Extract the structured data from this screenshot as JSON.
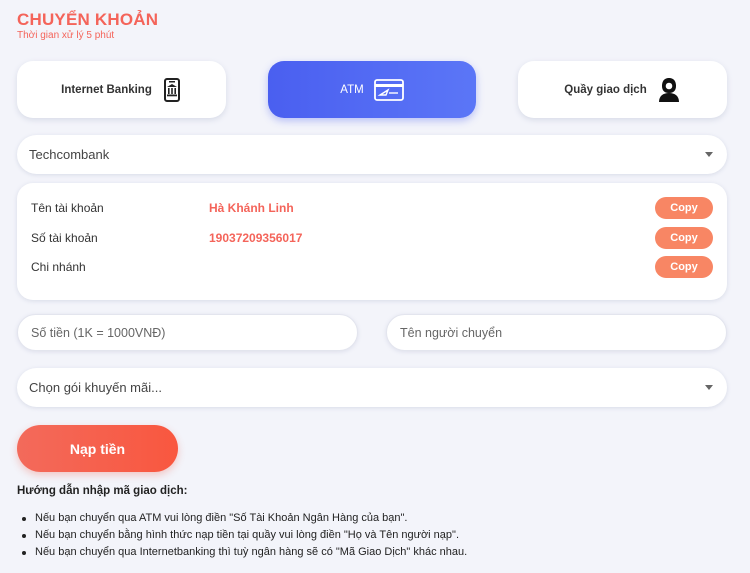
{
  "header": {
    "title": "CHUYỂN KHOẢN",
    "subtitle": "Thời gian xử lý 5 phút"
  },
  "methods": [
    {
      "label": "Internet Banking",
      "icon": "bank-phone-icon",
      "active": false
    },
    {
      "label": "ATM",
      "icon": "atm-card-icon",
      "active": true
    },
    {
      "label": "Quầy giao dịch",
      "icon": "teller-icon",
      "active": false
    }
  ],
  "bank_select": {
    "value": "Techcombank"
  },
  "account": {
    "rows": [
      {
        "key": "Tên tài khoản",
        "value": "Hà Khánh Linh",
        "copy": "Copy"
      },
      {
        "key": "Số tài khoản",
        "value": "19037209356017",
        "copy": "Copy"
      },
      {
        "key": "Chi nhánh",
        "value": "",
        "copy": "Copy"
      }
    ]
  },
  "form": {
    "amount_placeholder": "Số tiền (1K = 1000VNĐ)",
    "sender_placeholder": "Tên người chuyển"
  },
  "promo_select": {
    "value": "Chọn gói khuyến mãi..."
  },
  "submit_label": "Nạp tiền",
  "guide": {
    "title": "Hướng dẫn nhập mã giao dịch:",
    "items": [
      "Nếu bạn chuyển qua ATM vui lòng điền \"Số Tài Khoản Ngân Hàng của bạn\".",
      "Nếu bạn chuyển bằng hình thức nạp tiền tại quầy vui lòng điền \"Họ và Tên người nạp\".",
      "Nếu bạn chuyển qua Internetbanking thì tuỳ ngân hàng sẽ có \"Mã Giao Dịch\" khác nhau."
    ]
  },
  "colors": {
    "accent": "#f4645a",
    "active_tab": "#4a5ff0",
    "copy_button": "#f88664",
    "background": "#f3f4fa"
  }
}
